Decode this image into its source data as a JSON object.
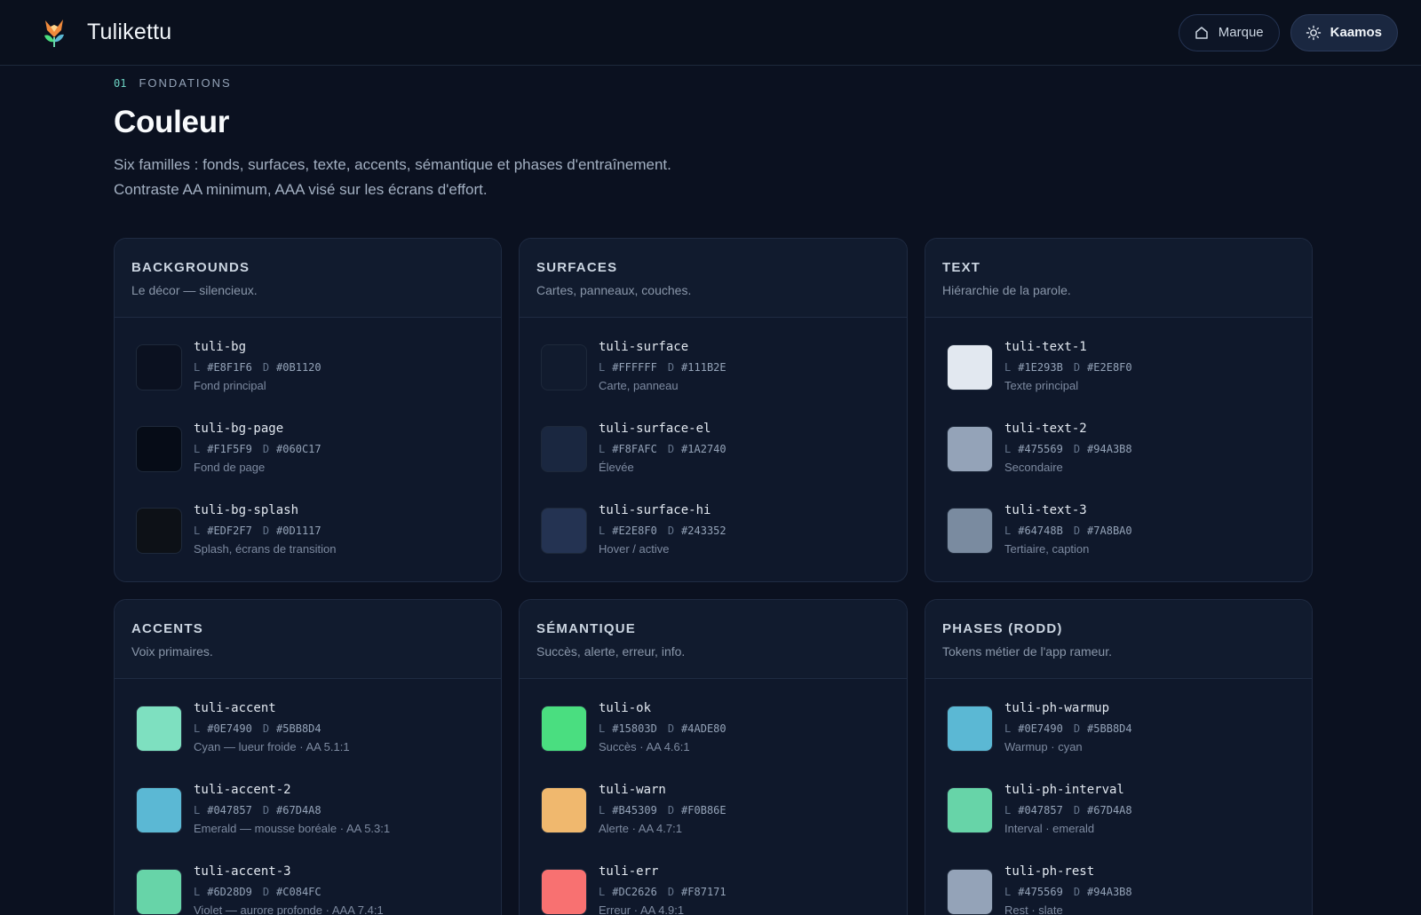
{
  "app": {
    "name": "Tulikettu"
  },
  "header": {
    "buttons": [
      {
        "label": "Marque",
        "icon": "home-icon",
        "active": false
      },
      {
        "label": "Kaamos",
        "icon": "sun-icon",
        "active": true
      }
    ]
  },
  "section": {
    "number": "01",
    "eyebrow": "FONDATIONS",
    "title": "Couleur",
    "lead_1": "Six familles : fonds, surfaces, texte, accents, sémantique et phases d'entraînement.",
    "lead_2": "Contraste AA minimum, AAA visé sur les écrans d'effort."
  },
  "labels": {
    "light": "L",
    "dark": "D"
  },
  "colors": {
    "accent": "#6dd4c4",
    "bg": "#0b1120",
    "card": "#0f182b"
  },
  "cards": [
    {
      "title": "BACKGROUNDS",
      "subtitle": "Le décor — silencieux.",
      "tokens": [
        {
          "name": "tuli-bg",
          "light": "#E8F1F6",
          "dark": "#0B1120",
          "desc": "Fond principal",
          "swatch": "#0b1120"
        },
        {
          "name": "tuli-bg-page",
          "light": "#F1F5F9",
          "dark": "#060C17",
          "desc": "Fond de page",
          "swatch": "#060c17"
        },
        {
          "name": "tuli-bg-splash",
          "light": "#EDF2F7",
          "dark": "#0D1117",
          "desc": "Splash, écrans de transition",
          "swatch": "#0d1117"
        }
      ]
    },
    {
      "title": "SURFACES",
      "subtitle": "Cartes, panneaux, couches.",
      "tokens": [
        {
          "name": "tuli-surface",
          "light": "#FFFFFF",
          "dark": "#111B2E",
          "desc": "Carte, panneau",
          "swatch": "#111b2e"
        },
        {
          "name": "tuli-surface-el",
          "light": "#F8FAFC",
          "dark": "#1A2740",
          "desc": "Élevée",
          "swatch": "#1a2740"
        },
        {
          "name": "tuli-surface-hi",
          "light": "#E2E8F0",
          "dark": "#243352",
          "desc": "Hover / active",
          "swatch": "#243352"
        }
      ]
    },
    {
      "title": "TEXT",
      "subtitle": "Hiérarchie de la parole.",
      "tokens": [
        {
          "name": "tuli-text-1",
          "light": "#1E293B",
          "dark": "#E2E8F0",
          "desc": "Texte principal",
          "swatch": "#e2e8f0"
        },
        {
          "name": "tuli-text-2",
          "light": "#475569",
          "dark": "#94A3B8",
          "desc": "Secondaire",
          "swatch": "#94a3b8"
        },
        {
          "name": "tuli-text-3",
          "light": "#64748B",
          "dark": "#7A8BA0",
          "desc": "Tertiaire, caption",
          "swatch": "#7a8ba0"
        }
      ]
    },
    {
      "title": "ACCENTS",
      "subtitle": "Voix primaires.",
      "tokens": [
        {
          "name": "tuli-accent",
          "light": "#0E7490",
          "dark": "#5BB8D4",
          "desc": "Cyan — lueur froide · AA 5.1:1",
          "swatch": "#7ee0c0"
        },
        {
          "name": "tuli-accent-2",
          "light": "#047857",
          "dark": "#67D4A8",
          "desc": "Emerald — mousse boréale · AA 5.3:1",
          "swatch": "#5bb8d4"
        },
        {
          "name": "tuli-accent-3",
          "light": "#6D28D9",
          "dark": "#C084FC",
          "desc": "Violet — aurore profonde · AAA 7.4:1",
          "swatch": "#67d4a8"
        }
      ]
    },
    {
      "title": "SÉMANTIQUE",
      "subtitle": "Succès, alerte, erreur, info.",
      "tokens": [
        {
          "name": "tuli-ok",
          "light": "#15803D",
          "dark": "#4ADE80",
          "desc": "Succès · AA 4.6:1",
          "swatch": "#4ade80"
        },
        {
          "name": "tuli-warn",
          "light": "#B45309",
          "dark": "#F0B86E",
          "desc": "Alerte · AA 4.7:1",
          "swatch": "#f0b86e"
        },
        {
          "name": "tuli-err",
          "light": "#DC2626",
          "dark": "#F87171",
          "desc": "Erreur · AA 4.9:1",
          "swatch": "#f87171"
        }
      ]
    },
    {
      "title": "PHASES (RODD)",
      "subtitle": "Tokens métier de l'app rameur.",
      "tokens": [
        {
          "name": "tuli-ph-warmup",
          "light": "#0E7490",
          "dark": "#5BB8D4",
          "desc": "Warmup · cyan",
          "swatch": "#5bb8d4"
        },
        {
          "name": "tuli-ph-interval",
          "light": "#047857",
          "dark": "#67D4A8",
          "desc": "Interval · emerald",
          "swatch": "#67d4a8"
        },
        {
          "name": "tuli-ph-rest",
          "light": "#475569",
          "dark": "#94A3B8",
          "desc": "Rest · slate",
          "swatch": "#94a3b8"
        }
      ]
    }
  ]
}
